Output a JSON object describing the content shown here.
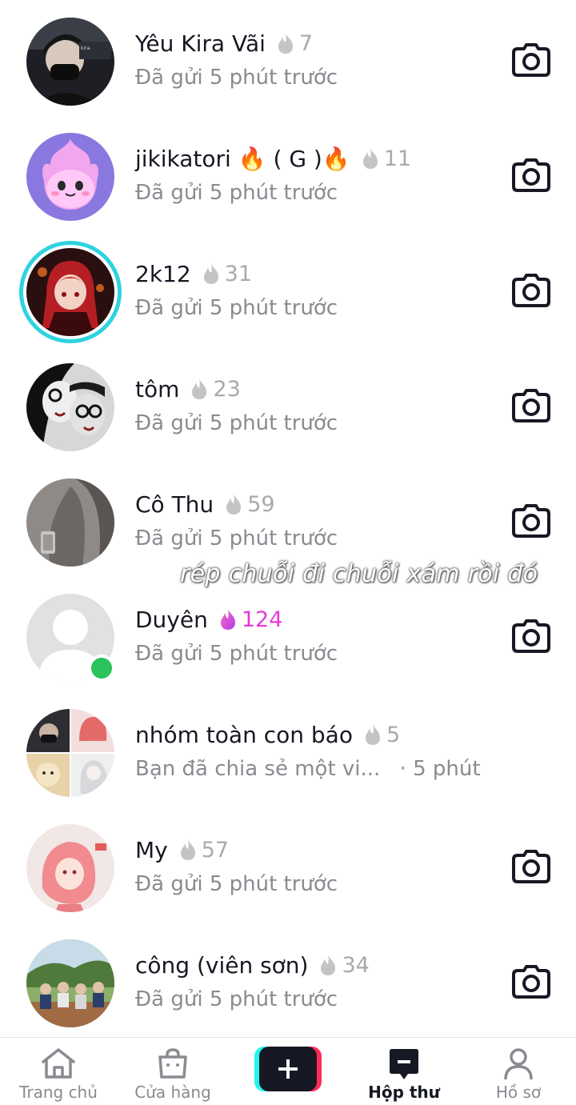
{
  "conversations": [
    {
      "name": "Yêu Kira Vãi",
      "streak": "7",
      "hot": false,
      "status": "Đã gửi 5 phút trước",
      "avatar": "dark-portrait",
      "camera": true
    },
    {
      "name": "jikikatori 🔥 ( G )🔥",
      "streak": "11",
      "hot": false,
      "status": "Đã gửi 5 phút trước",
      "avatar": "pink-flame-mascot",
      "camera": true
    },
    {
      "name": "2k12",
      "streak": "31",
      "hot": false,
      "status": "Đã gửi 5 phút trước",
      "avatar": "red-hair-anime",
      "camera": true,
      "ring": true
    },
    {
      "name": "tôm",
      "streak": "23",
      "hot": false,
      "status": "Đã gửi 5 phút trước",
      "avatar": "bw-selfie",
      "camera": true
    },
    {
      "name": "Cô Thu",
      "streak": "59",
      "hot": false,
      "status": "Đã gửi 5 phút trước",
      "avatar": "grey-photo",
      "camera": true
    },
    {
      "name": "Duyên",
      "streak": "124",
      "hot": true,
      "status": "Đã gửi 5 phút trước",
      "avatar": "default-avatar",
      "camera": true,
      "online": true
    },
    {
      "name": "nhóm toàn con báo",
      "streak": "5",
      "hot": false,
      "status": "Bạn đã chia sẻ một vi...",
      "status_time": "· 5 phút",
      "avatar": "group-collage",
      "camera": false
    },
    {
      "name": "My",
      "streak": "57",
      "hot": false,
      "status": "Đã gửi 5 phút trước",
      "avatar": "pink-anime-sketch",
      "camera": true
    },
    {
      "name": "công (viên sơn)",
      "streak": "34",
      "hot": false,
      "status": "Đã gửi 5 phút trước",
      "avatar": "group-outdoor",
      "camera": true
    }
  ],
  "overlay_caption": "rép chuỗi đi chuỗi xám rồi đó",
  "tabbar": {
    "home": "Trang chủ",
    "shop": "Cửa hàng",
    "inbox": "Hộp thư",
    "profile": "Hồ sơ"
  },
  "colors": {
    "streak_grey": "#aaaaaa",
    "streak_hot": "#e63bd8",
    "online": "#2bc35a",
    "story_ring": "#2ed3e0"
  }
}
